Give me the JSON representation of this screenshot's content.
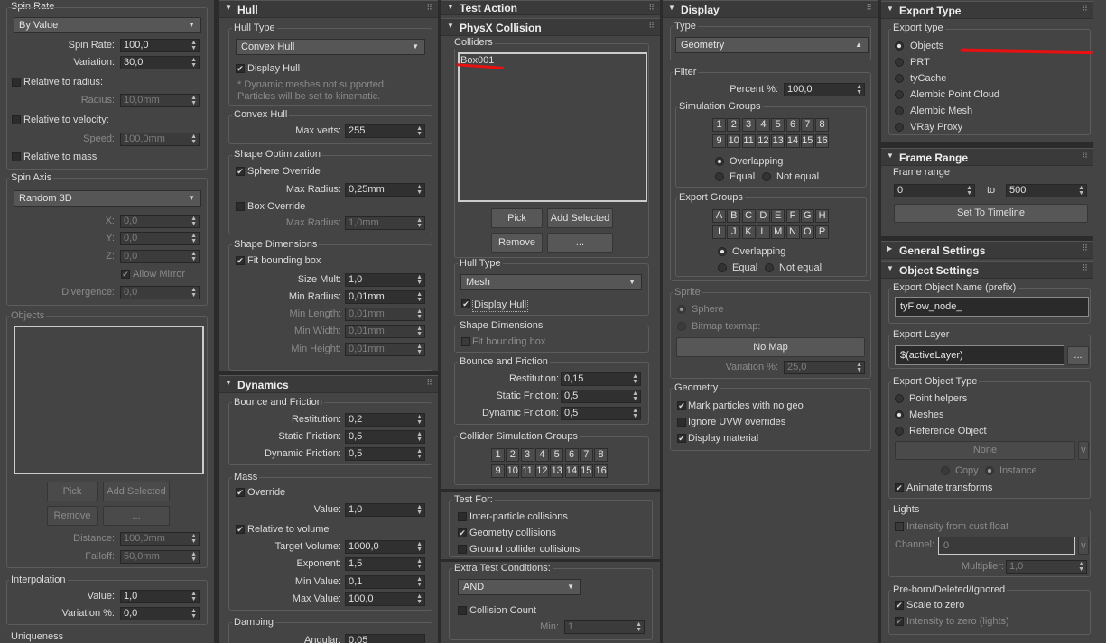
{
  "c1": {
    "spin_rate": "Spin Rate",
    "by_value": "By Value",
    "spin_rate_lbl": "Spin Rate:",
    "spin_rate_val": "100,0",
    "variation_lbl": "Variation:",
    "variation_val": "30,0",
    "rel_radius": "Relative to radius:",
    "radius_lbl": "Radius:",
    "radius_val": "10,0mm",
    "rel_velocity": "Relative to velocity:",
    "speed_lbl": "Speed:",
    "speed_val": "100,0mm",
    "rel_mass": "Relative to mass",
    "spin_axis": "Spin Axis",
    "random3d": "Random 3D",
    "x_lbl": "X:",
    "x_val": "0,0",
    "y_lbl": "Y:",
    "y_val": "0,0",
    "z_lbl": "Z:",
    "z_val": "0,0",
    "allow_mirror": "Allow Mirror",
    "divergence_lbl": "Divergence:",
    "divergence_val": "0,0",
    "objects": "Objects",
    "pick": "Pick",
    "add_selected": "Add Selected",
    "remove": "Remove",
    "ellipsis": "...",
    "distance_lbl": "Distance:",
    "distance_val": "100,0mm",
    "falloff_lbl": "Falloff:",
    "falloff_val": "50,0mm",
    "interpolation": "Interpolation",
    "value_lbl": "Value:",
    "value_val": "1,0",
    "variation_pct_lbl": "Variation %:",
    "variation_pct_val": "0,0",
    "uniqueness": "Uniqueness"
  },
  "c2": {
    "hull": "Hull",
    "hull_type": "Hull Type",
    "convex_hull": "Convex Hull",
    "display_hull": "Display Hull",
    "note": "* Dynamic meshes not supported. Particles will be set to kinematic.",
    "convex_hull_grp": "Convex Hull",
    "max_verts_lbl": "Max verts:",
    "max_verts_val": "255",
    "shape_opt": "Shape Optimization",
    "sphere_override": "Sphere Override",
    "max_radius_lbl": "Max Radius:",
    "max_radius_val": "0,25mm",
    "box_override": "Box Override",
    "max_radius2_lbl": "Max Radius:",
    "max_radius2_val": "1,0mm",
    "shape_dims": "Shape Dimensions",
    "fit_bbox": "Fit bounding box",
    "size_mult_lbl": "Size Mult:",
    "size_mult_val": "1,0",
    "min_radius_lbl": "Min Radius:",
    "min_radius_val": "0,01mm",
    "min_length_lbl": "Min Length:",
    "min_length_val": "0,01mm",
    "min_width_lbl": "Min Width:",
    "min_width_val": "0,01mm",
    "min_height_lbl": "Min Height:",
    "min_height_val": "0,01mm",
    "dynamics": "Dynamics",
    "bounce_friction": "Bounce and Friction",
    "restitution_lbl": "Restitution:",
    "restitution_val": "0,2",
    "static_fric_lbl": "Static Friction:",
    "static_fric_val": "0,5",
    "dynamic_fric_lbl": "Dynamic Friction:",
    "dynamic_fric_val": "0,5",
    "mass": "Mass",
    "override": "Override",
    "mvalue_lbl": "Value:",
    "mvalue_val": "1,0",
    "rel_volume": "Relative to volume",
    "target_vol_lbl": "Target Volume:",
    "target_vol_val": "1000,0",
    "exponent_lbl": "Exponent:",
    "exponent_val": "1,5",
    "min_value_lbl": "Min Value:",
    "min_value_val": "0,1",
    "max_value_lbl": "Max Value:",
    "max_value_val": "100,0",
    "damping": "Damping",
    "angular_lbl": "Angular:",
    "angular_val": "0,05"
  },
  "c3": {
    "test_action": "Test Action",
    "physx": "PhysX Collision",
    "colliders": "Colliders",
    "box001": "Box001",
    "pick": "Pick",
    "add_selected": "Add Selected",
    "remove": "Remove",
    "ellipsis": "...",
    "hull_type": "Hull Type",
    "mesh": "Mesh",
    "display_hull": "Display Hull",
    "shape_dims": "Shape Dimensions",
    "fit_bbox": "Fit bounding box",
    "bounce_friction": "Bounce and Friction",
    "restitution_lbl": "Restitution:",
    "restitution_val": "0,15",
    "static_fric_lbl": "Static Friction:",
    "static_fric_val": "0,5",
    "dynamic_fric_lbl": "Dynamic Friction:",
    "dynamic_fric_val": "0,5",
    "collider_groups": "Collider Simulation Groups",
    "groups_row1": [
      "1",
      "2",
      "3",
      "4",
      "5",
      "6",
      "7",
      "8"
    ],
    "groups_row2": [
      "9",
      "10",
      "11",
      "12",
      "13",
      "14",
      "15",
      "16"
    ],
    "test_for": "Test For:",
    "inter_particle": "Inter-particle collisions",
    "geometry_coll": "Geometry collisions",
    "ground_coll": "Ground collider collisions",
    "extra_test": "Extra Test Conditions:",
    "and": "AND",
    "collision_count": "Collision Count",
    "min_lbl": "Min:",
    "min_val": "1"
  },
  "c4": {
    "display": "Display",
    "type": "Type",
    "geometry": "Geometry",
    "filter": "Filter",
    "percent_lbl": "Percent %:",
    "percent_val": "100,0",
    "sim_groups": "Simulation Groups",
    "nums_row1": [
      "1",
      "2",
      "3",
      "4",
      "5",
      "6",
      "7",
      "8"
    ],
    "nums_row2": [
      "9",
      "10",
      "11",
      "12",
      "13",
      "14",
      "15",
      "16"
    ],
    "overlapping": "Overlapping",
    "equal": "Equal",
    "not_equal": "Not equal",
    "export_groups": "Export Groups",
    "letters_row1": [
      "A",
      "B",
      "C",
      "D",
      "E",
      "F",
      "G",
      "H"
    ],
    "letters_row2": [
      "I",
      "J",
      "K",
      "L",
      "M",
      "N",
      "O",
      "P"
    ],
    "sprite": "Sprite",
    "sphere": "Sphere",
    "bitmap": "Bitmap texmap:",
    "no_map": "No Map",
    "variation_lbl": "Variation %:",
    "variation_val": "25,0",
    "geometry_grp": "Geometry",
    "mark_particles": "Mark particles with no geo",
    "ignore_uvw": "Ignore UVW overrides",
    "display_material": "Display material"
  },
  "c5": {
    "export_type": "Export Type",
    "export_type_lbl": "Export type",
    "options": [
      "Objects",
      "PRT",
      "tyCache",
      "Alembic Point Cloud",
      "Alembic Mesh",
      "VRay Proxy"
    ],
    "frame_range_hdr": "Frame Range",
    "frame_range_lbl": "Frame range",
    "from_val": "0",
    "to_lbl": "to",
    "to_val": "500",
    "set_timeline": "Set To Timeline",
    "general": "General Settings",
    "object_settings": "Object Settings",
    "export_name_lbl": "Export Object Name (prefix)",
    "export_name_val": "tyFlow_node_",
    "export_layer_lbl": "Export Layer",
    "export_layer_val": "$(activeLayer)",
    "ellipsis": "...",
    "export_obj_type": "Export Object Type",
    "point_helpers": "Point helpers",
    "meshes": "Meshes",
    "reference_object": "Reference Object",
    "none": "None",
    "v": "v",
    "copy": "Copy",
    "instance": "Instance",
    "animate_transforms": "Animate transforms",
    "lights": "Lights",
    "intensity_cust": "Intensity from cust float",
    "channel_lbl": "Channel:",
    "channel_val": "0",
    "multiplier_lbl": "Multiplier:",
    "multiplier_val": "1,0",
    "preborn": "Pre-born/Deleted/Ignored",
    "scale_zero": "Scale to zero",
    "intensity_zero": "Intensity to zero (lights)"
  }
}
